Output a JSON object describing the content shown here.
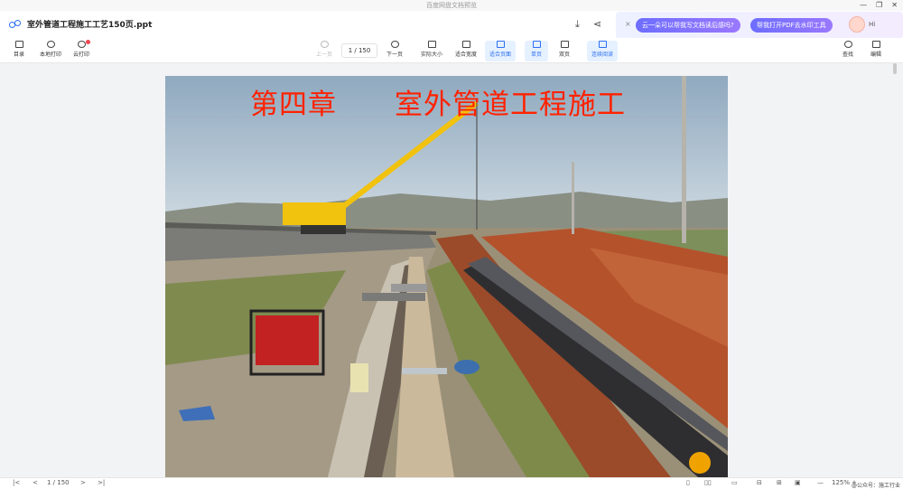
{
  "window": {
    "title": "百度网盘文档预览",
    "min": "—",
    "restore": "❐",
    "close": "✕"
  },
  "file": {
    "name": "室外管道工程施工工艺150页.ppt"
  },
  "ai": {
    "close": "×",
    "prompt1": "云一朵可以帮我写文档读后感吗?",
    "prompt2": "帮我打开PDF去水印工具",
    "greeting": "Hi"
  },
  "toolbar": {
    "toc": "目录",
    "local_print": "本地打印",
    "cloud_print": "云打印",
    "prev": "上一页",
    "page_value": "1 / 150",
    "next": "下一页",
    "actual_size": "实际大小",
    "fit_width": "适合宽度",
    "fit_page": "适合页面",
    "single": "单页",
    "double": "双页",
    "continuous": "连续阅读",
    "search": "查找",
    "edit": "编辑"
  },
  "slide": {
    "title": "第四章　　室外管道工程施工"
  },
  "status": {
    "first": "|<",
    "prev": "<",
    "page": "1 / 150",
    "next": ">",
    "last": ">|",
    "zoom": "125%",
    "zoom_minus": "—",
    "zoom_plus": "+",
    "watermark": "@公众号：施工行业"
  },
  "colors": {
    "accent": "#2b6ff2",
    "title_red": "#ff2200",
    "ai_pill": "#7a6dff"
  }
}
